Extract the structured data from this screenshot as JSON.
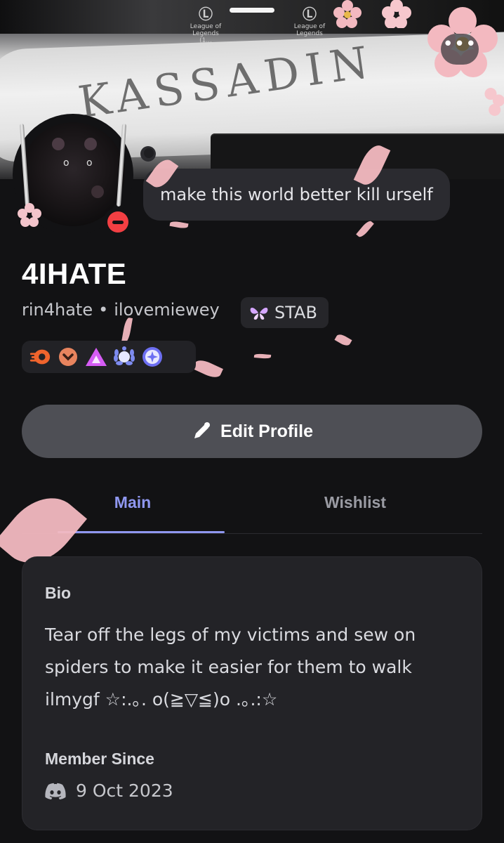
{
  "banner": {
    "scratch_text": "KASSADIN",
    "logo_top_label_1": "League of Legends (1...",
    "logo_top_label_2": "League of Legends",
    "more_label": "•••"
  },
  "status": {
    "custom_text": "make this world better kill urself"
  },
  "profile": {
    "display_name": "4IHATE",
    "username": "rin4hate",
    "separator": "•",
    "pronouns": "ilovemiewey",
    "server_tag": "STAB",
    "presence": "do-not-disturb"
  },
  "badges": [
    {
      "icon": "nitro-icon",
      "color": "#f0642d"
    },
    {
      "icon": "boost-icon",
      "color": "#e8845e"
    },
    {
      "icon": "hypesquad-icon",
      "color": "#d65cf5"
    },
    {
      "icon": "laurel-icon",
      "color": "#7d8bf0"
    },
    {
      "icon": "quest-icon",
      "color": "#6d6ff2"
    }
  ],
  "actions": {
    "edit_profile_label": "Edit Profile"
  },
  "tabs": [
    {
      "label": "Main",
      "active": true
    },
    {
      "label": "Wishlist",
      "active": false
    }
  ],
  "card": {
    "bio_label": "Bio",
    "bio_text": "Tear off the legs of my victims and sew on spiders to make it easier for them to walk ilmygf ☆:.｡. o(≧▽≦)o .｡.:☆",
    "member_since_label": "Member Since",
    "member_since_date": "9 Oct 2023"
  },
  "colors": {
    "accent": "#8f97f0",
    "dnd": "#f23f43",
    "petal": "#f3b9c0",
    "background": "#121214"
  }
}
